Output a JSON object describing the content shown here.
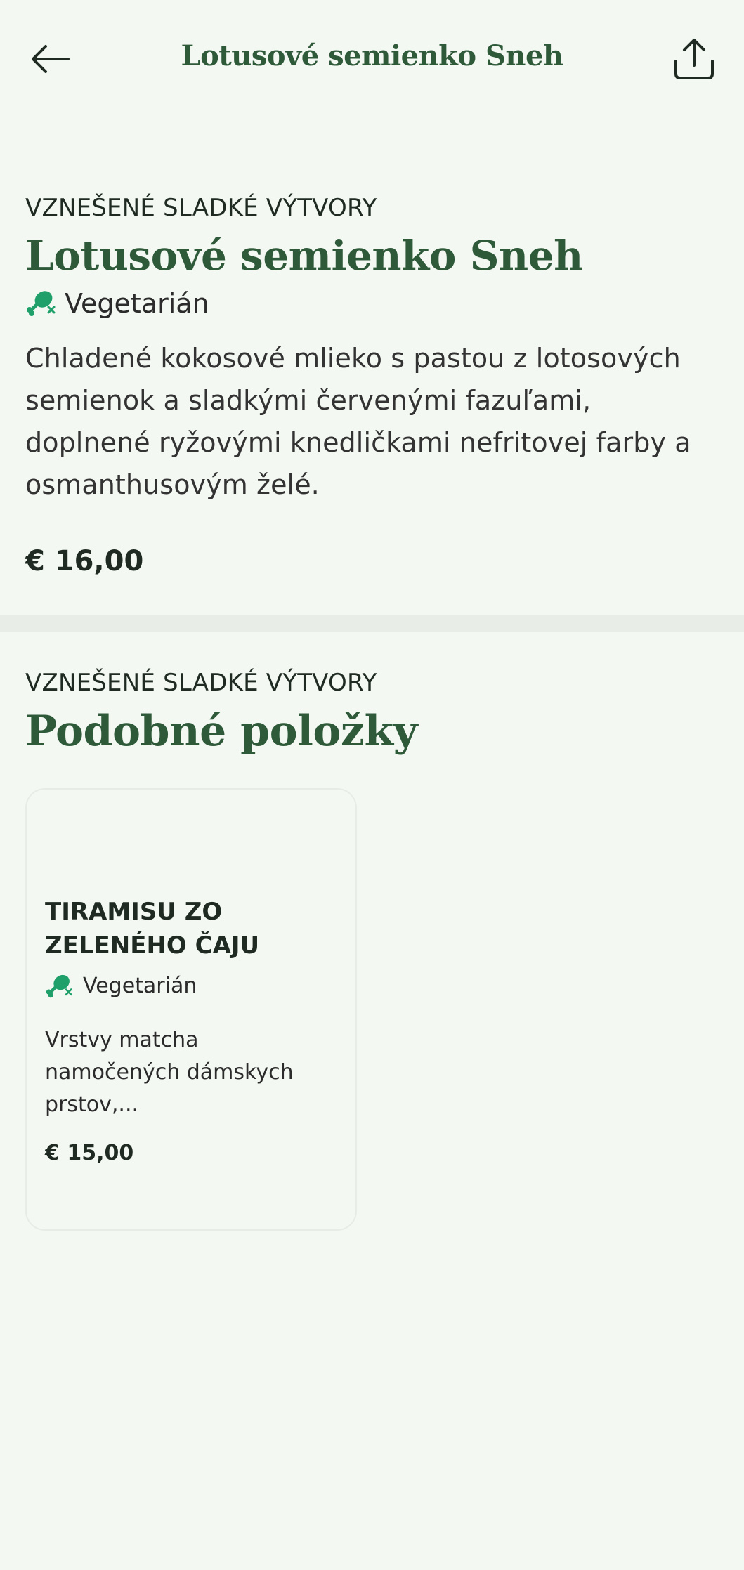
{
  "header": {
    "title": "Lotusové semienko Sneh",
    "back_icon": "arrow-left-icon",
    "share_icon": "share-icon"
  },
  "product": {
    "category": "VZNEŠENÉ SLADKÉ VÝTVORY",
    "title": "Lotusové semienko Sneh",
    "diet_label": "Vegetarián",
    "diet_icon": "vegetarian-drumstick-icon",
    "description": "Chladené kokosové mlieko s pastou z lotosových semienok a sladkými červenými fazuľami, doplnené ryžovými knedličkami nefritovej farby a osmanthusovým želé.",
    "price": "€ 16,00"
  },
  "similar": {
    "category": "VZNEŠENÉ SLADKÉ VÝTVORY",
    "title": "Podobné položky",
    "items": [
      {
        "name": "TIRAMISU ZO ZELENÉHO ČAJU",
        "diet_label": "Vegetarián",
        "description": "Vrstvy matcha namočených dámskych prstov,...",
        "price": "€ 15,00"
      }
    ]
  },
  "colors": {
    "background": "#f3f8f2",
    "accent_green": "#2f5a3a",
    "icon_green": "#1fa06a"
  }
}
